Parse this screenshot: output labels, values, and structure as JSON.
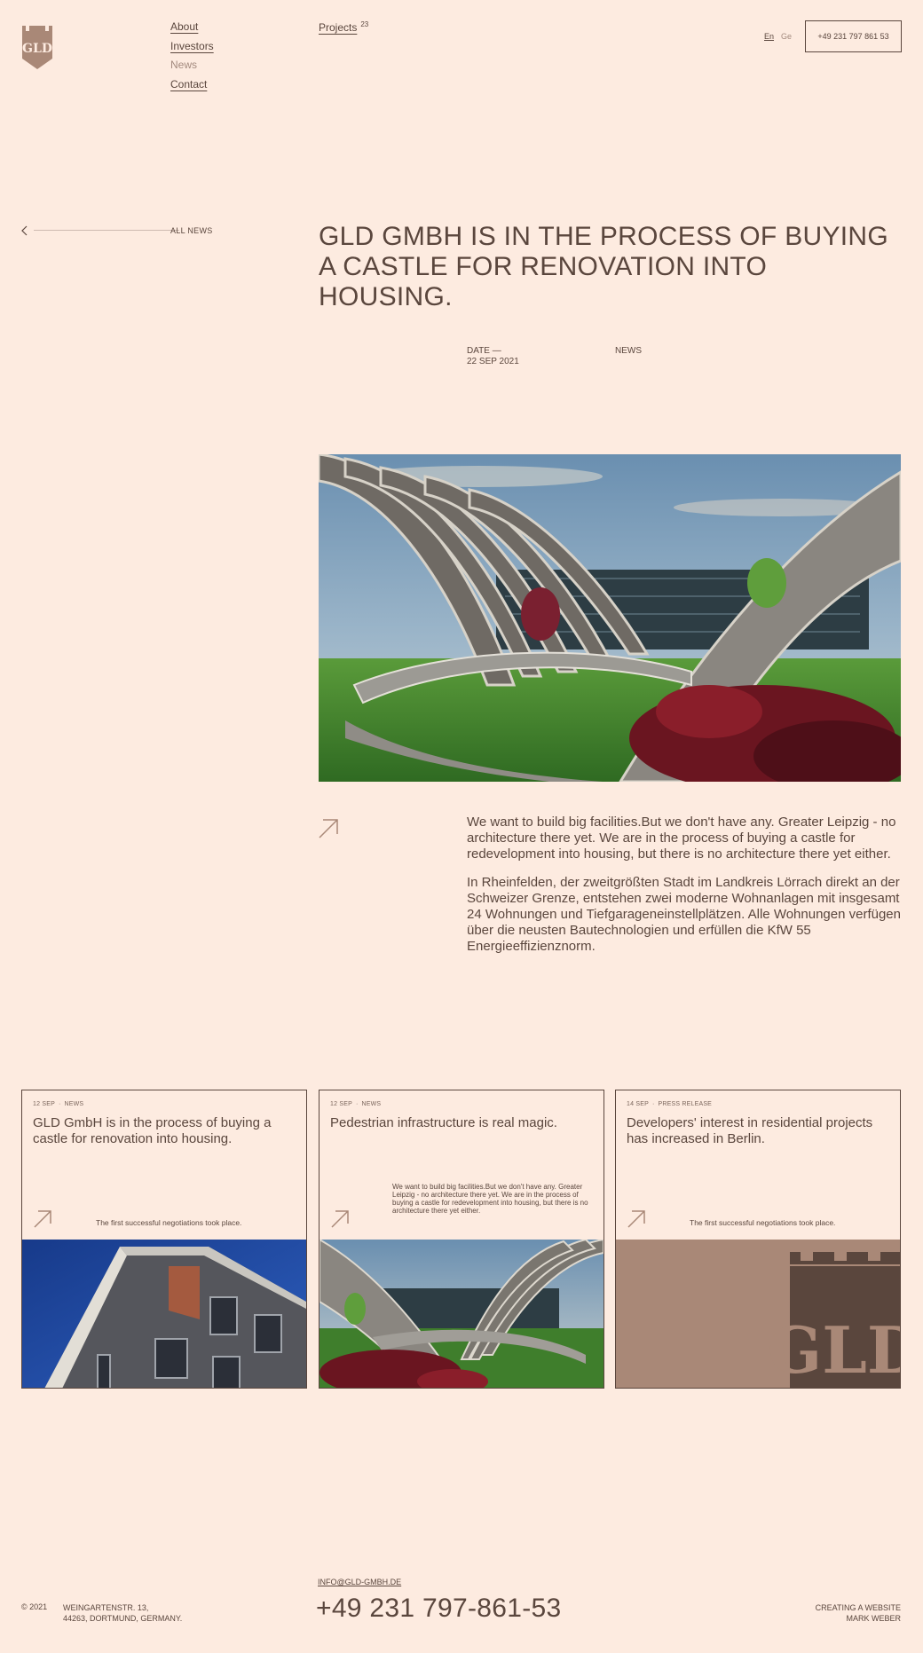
{
  "header": {
    "nav": [
      "About",
      "Investors",
      "News",
      "Contact"
    ],
    "projects_label": "Projects",
    "projects_count": "23",
    "lang_en": "En",
    "lang_ge": "Ge",
    "phone_button": "+49 231 797 861 53"
  },
  "back": {
    "label": "ALL NEWS"
  },
  "article": {
    "title": "GLD GMBH IS IN THE PROCESS OF BUYING A CASTLE FOR RENOVATION INTO HOUSING.",
    "date_label": "DATE —",
    "date": "22 SEP 2021",
    "category": "NEWS",
    "p1": "We want to build big facilities.But we don't have any. Greater Leipzig - no architecture there yet. We are in the process of buying a castle for redevelopment into housing, but there is no architecture there yet either.",
    "p2": "In Rheinfelden, der zweitgrößten Stadt im Landkreis Lörrach direkt an der Schweizer Grenze, entstehen zwei moderne Wohnanlagen mit insgesamt 24 Wohnungen und Tiefgarageneinstellplätzen. Alle Wohnungen verfügen über die neusten Bautechnologien und erfüllen die KfW 55 Energieeffizienznorm."
  },
  "cards": [
    {
      "date": "12 SEP",
      "category": "NEWS",
      "title": "GLD GmbH is in the process of buying a castle for renovation into housing.",
      "desc": "The first successful negotiations took place."
    },
    {
      "date": "12 SEP",
      "category": "NEWS",
      "title": "Pedestrian infrastructure is real magic.",
      "desc": "We want to build big facilities.But we don't have any. Greater Leipzig - no architecture there yet. We are in the process of buying a castle for redevelopment into housing, but there is no architecture there yet either."
    },
    {
      "date": "14 SEP",
      "category": "PRESS RELEASE",
      "title": "Developers' interest in residential projects has increased in Berlin.",
      "desc": "The first successful negotiations took place."
    }
  ],
  "footer": {
    "copyright": "© 2021",
    "address_line1": "WEINGARTENSTR. 13,",
    "address_line2": "44263, DORTMUND, GERMANY.",
    "email": "INFO@GLD-GMBH.DE",
    "phone": "+49 231 797-861-53",
    "credit_line1": "CREATING A WEBSITE",
    "credit_line2": "MARK WEBER"
  },
  "logo_text": "GLD",
  "colors": {
    "background": "#fdebe0",
    "text": "#5a463d",
    "accent": "#a98877"
  }
}
